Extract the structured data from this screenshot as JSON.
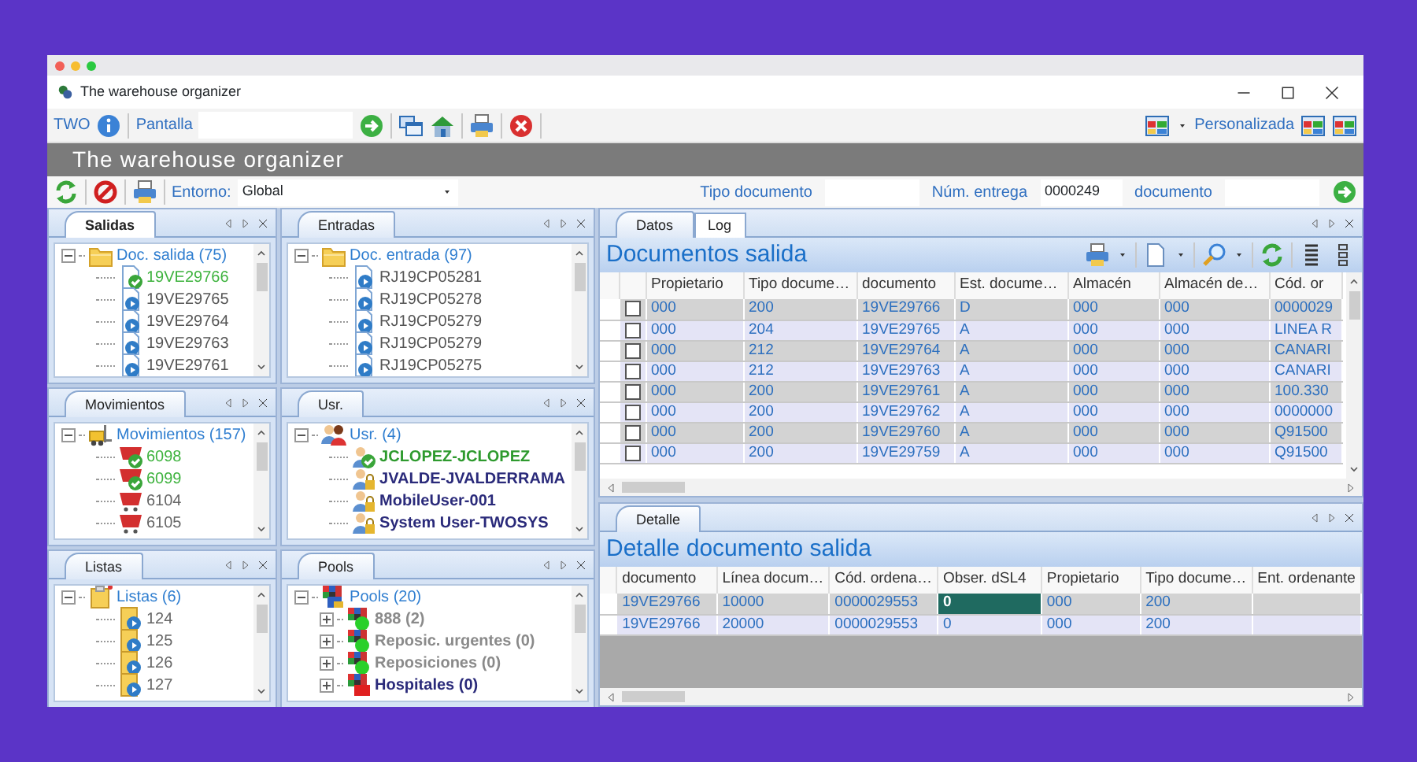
{
  "window": {
    "title": "The warehouse organizer"
  },
  "toolbar": {
    "app_label": "TWO",
    "screen_label": "Pantalla",
    "layout_label": "Personalizada"
  },
  "banner": {
    "title": "The warehouse organizer"
  },
  "filter_bar": {
    "environment_label": "Entorno:",
    "environment_value": "Global",
    "document_type_label": "Tipo documento",
    "delivery_label": "Núm. entrega",
    "delivery_value": "0000249",
    "document_label": "documento"
  },
  "panels": [
    {
      "tab": "Salidas",
      "selected": true,
      "root": {
        "kind": "folder",
        "label": "Doc. salida (75)",
        "expanded": true,
        "children": [
          {
            "kind": "doc-ok",
            "label": "19VE29766"
          },
          {
            "kind": "doc",
            "label": "19VE29765"
          },
          {
            "kind": "doc",
            "label": "19VE29764"
          },
          {
            "kind": "doc",
            "label": "19VE29763"
          },
          {
            "kind": "doc",
            "label": "19VE29761"
          }
        ]
      }
    },
    {
      "tab": "Entradas",
      "selected": false,
      "root": {
        "kind": "folder",
        "label": "Doc. entrada (97)",
        "expanded": true,
        "children": [
          {
            "kind": "doc",
            "label": "RJ19CP05281"
          },
          {
            "kind": "doc",
            "label": "RJ19CP05278"
          },
          {
            "kind": "doc",
            "label": "RJ19CP05279"
          },
          {
            "kind": "doc",
            "label": "RJ19CP05279"
          },
          {
            "kind": "doc",
            "label": "RJ19CP05275"
          }
        ]
      }
    },
    {
      "tab": "Movimientos",
      "selected": false,
      "root": {
        "kind": "forklift",
        "label": "Movimientos (157)",
        "expanded": true,
        "children": [
          {
            "kind": "move-ok",
            "label": "6098"
          },
          {
            "kind": "move-ok",
            "label": "6099"
          },
          {
            "kind": "move",
            "label": "6104"
          },
          {
            "kind": "move",
            "label": "6105"
          }
        ]
      }
    },
    {
      "tab": "Usr.",
      "selected": false,
      "root": {
        "kind": "users",
        "label": "Usr. (4)",
        "expanded": true,
        "children": [
          {
            "kind": "user-ok",
            "label": "JCLOPEZ-JCLOPEZ"
          },
          {
            "kind": "user",
            "label": "JVALDE-JVALDERRAMA"
          },
          {
            "kind": "user",
            "label": "MobileUser-001"
          },
          {
            "kind": "user",
            "label": "System User-TWOSYS"
          }
        ]
      }
    },
    {
      "tab": "Listas",
      "selected": false,
      "root": {
        "kind": "lists",
        "label": "Listas (6)",
        "expanded": true,
        "children": [
          {
            "kind": "list",
            "label": "124"
          },
          {
            "kind": "list",
            "label": "125"
          },
          {
            "kind": "list",
            "label": "126"
          },
          {
            "kind": "list",
            "label": "127"
          }
        ]
      }
    },
    {
      "tab": "Pools",
      "selected": false,
      "root": {
        "kind": "pools",
        "label": "Pools (20)",
        "expanded": true,
        "children": [
          {
            "kind": "pool",
            "label": "888 (2)",
            "expanded": false
          },
          {
            "kind": "pool",
            "label": "Reposic. urgentes (0)",
            "expanded": false
          },
          {
            "kind": "pool",
            "label": "Reposiciones (0)",
            "expanded": false
          },
          {
            "kind": "pool-alert",
            "label": "Hospitales (0)",
            "expanded": false
          }
        ]
      }
    }
  ],
  "main": {
    "tabs": [
      {
        "label": "Datos",
        "selected": true
      },
      {
        "label": "Log",
        "selected": false
      }
    ],
    "title": "Documentos salida",
    "columns": [
      "Propietario",
      "Tipo docume…",
      "documento",
      "Est. docume…",
      "Almacén",
      "Almacén de…",
      "Cód. or"
    ],
    "rows": [
      {
        "checked": false,
        "cells": [
          "000",
          "200",
          "19VE29766",
          "D",
          "000",
          "000",
          "0000029"
        ]
      },
      {
        "checked": false,
        "cells": [
          "000",
          "204",
          "19VE29765",
          "A",
          "000",
          "000",
          "LINEA R"
        ]
      },
      {
        "checked": false,
        "cells": [
          "000",
          "212",
          "19VE29764",
          "A",
          "000",
          "000",
          "CANARI"
        ]
      },
      {
        "checked": false,
        "cells": [
          "000",
          "212",
          "19VE29763",
          "A",
          "000",
          "000",
          "CANARI"
        ]
      },
      {
        "checked": false,
        "cells": [
          "000",
          "200",
          "19VE29761",
          "A",
          "000",
          "000",
          "100.330"
        ]
      },
      {
        "checked": false,
        "cells": [
          "000",
          "200",
          "19VE29762",
          "A",
          "000",
          "000",
          "0000000"
        ]
      },
      {
        "checked": false,
        "cells": [
          "000",
          "200",
          "19VE29760",
          "A",
          "000",
          "000",
          "Q91500"
        ]
      },
      {
        "checked": false,
        "cells": [
          "000",
          "200",
          "19VE29759",
          "A",
          "000",
          "000",
          "Q91500"
        ]
      }
    ]
  },
  "detail": {
    "tabs": [
      {
        "label": "Detalle",
        "selected": true
      }
    ],
    "title": "Detalle documento salida",
    "columns": [
      "documento",
      "Línea docum…",
      "Cód. ordena…",
      "Obser. dSL4",
      "Propietario",
      "Tipo docume…",
      "Ent. ordenante"
    ],
    "rows": [
      {
        "cells": [
          {
            "text": "19VE29766",
            "selected": false
          },
          {
            "text": "10000",
            "selected": false
          },
          {
            "text": "0000029553",
            "selected": false
          },
          {
            "text": "0",
            "selected": true
          },
          {
            "text": "000",
            "selected": false
          },
          {
            "text": "200",
            "selected": false
          }
        ]
      },
      {
        "cells": [
          {
            "text": "19VE29766",
            "selected": false
          },
          {
            "text": "20000",
            "selected": false
          },
          {
            "text": "0000029553",
            "selected": false
          },
          {
            "text": "0",
            "selected": false
          },
          {
            "text": "000",
            "selected": false
          },
          {
            "text": "200",
            "selected": false
          }
        ]
      }
    ]
  }
}
